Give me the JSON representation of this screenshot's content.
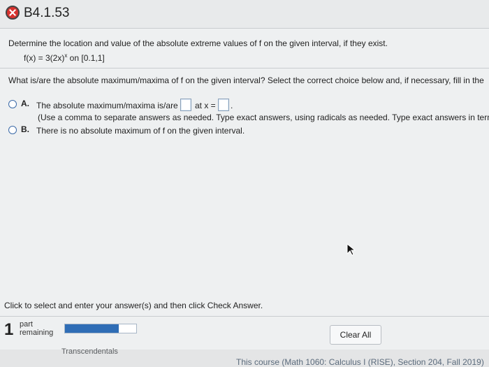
{
  "header": {
    "problem_id": "B4.1.53",
    "status": "incorrect"
  },
  "question": {
    "text": "Determine the location and value of the absolute extreme values of f on the given interval, if they exist.",
    "function_lhs": "f(x) = 3(2x)",
    "function_exp": "x",
    "interval": " on [0.1,1]"
  },
  "prompt": "What is/are the absolute maximum/maxima of f on the given interval? Select the correct choice below and, if necessary, fill in the",
  "options": {
    "a": {
      "letter": "A.",
      "text_before": "The absolute maximum/maxima is/are",
      "text_mid": "at x =",
      "text_end": ".",
      "note": "(Use a comma to separate answers as needed. Type exact answers, using radicals as needed. Type exact answers in term"
    },
    "b": {
      "letter": "B.",
      "text": "There is no absolute maximum of f on the given interval."
    }
  },
  "footer": {
    "instruction": "Click to select and enter your answer(s) and then click Check Answer.",
    "parts_count": "1",
    "parts_label_1": "part",
    "parts_label_2": "remaining",
    "progress": 0.75,
    "clear_all": "Clear All",
    "clipped_text": "Transcendentals",
    "course": "This course (Math 1060: Calculus I (RISE), Section 204, Fall 2019)"
  }
}
